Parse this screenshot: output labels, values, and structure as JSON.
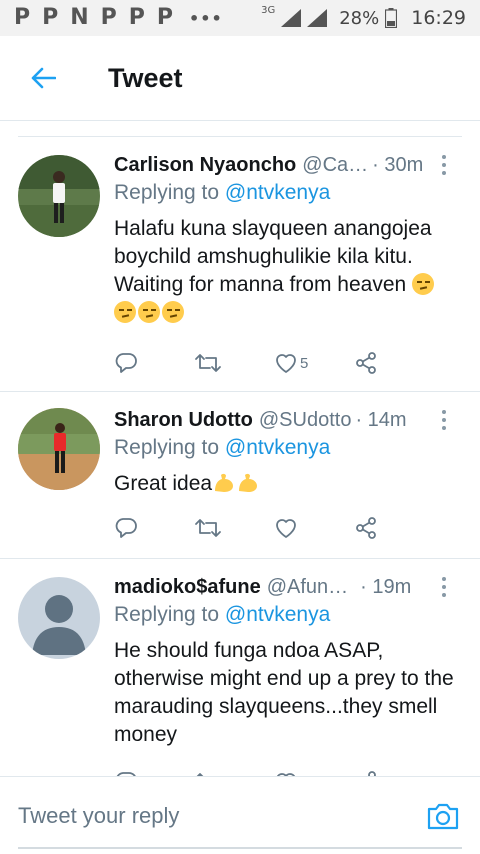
{
  "status_bar": {
    "notif_icons": [
      "P",
      "P",
      "N",
      "P",
      "P",
      "P"
    ],
    "more": "•••",
    "network": "3G",
    "battery": "28%",
    "time": "16:29"
  },
  "header": {
    "title": "Tweet",
    "back_icon": "arrow-left-icon"
  },
  "tweets": [
    {
      "name": "Carlison Nyaoncho",
      "handle": "@Ca…",
      "time": "· 30m",
      "replying_prefix": "Replying to",
      "replying_to": "@ntvkenya",
      "text": "Halafu kuna slayqueen anangojea boychild amshughulikie kila kitu. Waiting for manna from heaven",
      "emoji_count": 4,
      "likes": "5"
    },
    {
      "name": "Sharon Udotto",
      "handle": "@SUdotto",
      "time": "· 14m",
      "replying_prefix": "Replying to",
      "replying_to": "@ntvkenya",
      "text": "Great idea",
      "likes": ""
    },
    {
      "name": "madioko$afune",
      "handle": "@Afun…",
      "time": "· 19m",
      "replying_prefix": "Replying to",
      "replying_to": "@ntvkenya",
      "text": "He should funga ndoa ASAP, otherwise might end up a prey to the marauding slayqueens...they smell money"
    }
  ],
  "reply_bar": {
    "placeholder": "Tweet your reply",
    "camera_icon": "camera-icon"
  },
  "colors": {
    "accent": "#1da1f2",
    "secondary_text": "#657786",
    "primary_text": "#14171a",
    "divider": "#e1e8ed"
  }
}
